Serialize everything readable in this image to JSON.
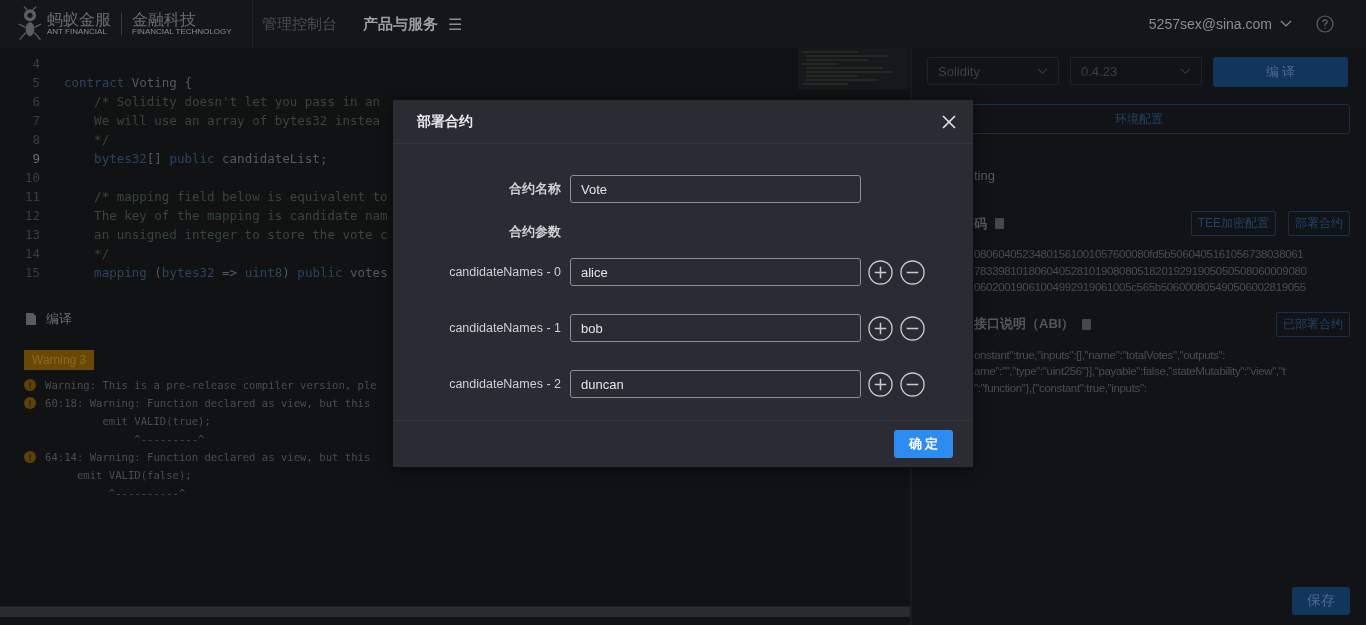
{
  "header": {
    "logo": {
      "brand": "蚂蚁金服",
      "brand_sub": "ANT FINANCIAL",
      "product": "金融科技",
      "product_sub": "FINANCIAL TECHNOLOGY"
    },
    "nav": [
      {
        "label": "管理控制台",
        "selected": false
      },
      {
        "label": "产品与服务",
        "selected": true
      }
    ],
    "menu_glyph": "☰",
    "user": "5257sex@sina.com"
  },
  "editor": {
    "lines": [
      {
        "number": "4",
        "active": false
      },
      {
        "number": "5",
        "active": false,
        "tokens": [
          {
            "kind": "keyword",
            "text": "contract"
          },
          {
            "kind": "plain",
            "text": " Voting {"
          }
        ]
      },
      {
        "number": "6",
        "active": false,
        "tokens": [
          {
            "kind": "comment",
            "text": "    /* Solidity doesn't let you pass in an"
          }
        ]
      },
      {
        "number": "7",
        "active": false,
        "tokens": [
          {
            "kind": "comment",
            "text": "    We will use an array of bytes32 instea"
          }
        ]
      },
      {
        "number": "8",
        "active": false,
        "tokens": [
          {
            "kind": "comment",
            "text": "    */"
          }
        ]
      },
      {
        "number": "9",
        "active": true,
        "tokens": [
          {
            "kind": "keyword",
            "text": "    bytes32"
          },
          {
            "kind": "plain",
            "text": "[] "
          },
          {
            "kind": "keyword",
            "text": "public"
          },
          {
            "kind": "plain",
            "text": " candidateList;"
          }
        ]
      },
      {
        "number": "10",
        "active": false
      },
      {
        "number": "11",
        "active": false,
        "tokens": [
          {
            "kind": "comment",
            "text": "    /* mapping field below is equivalent to"
          }
        ]
      },
      {
        "number": "12",
        "active": false,
        "tokens": [
          {
            "kind": "comment",
            "text": "    The key of the mapping is candidate nam"
          }
        ]
      },
      {
        "number": "13",
        "active": false,
        "tokens": [
          {
            "kind": "comment",
            "text": "    an unsigned integer to store the vote c"
          }
        ]
      },
      {
        "number": "14",
        "active": false,
        "tokens": [
          {
            "kind": "comment",
            "text": "    */"
          }
        ]
      },
      {
        "number": "15",
        "active": false,
        "tokens": [
          {
            "kind": "keyword",
            "text": "    mapping"
          },
          {
            "kind": "plain",
            "text": " ("
          },
          {
            "kind": "keyword",
            "text": "bytes32"
          },
          {
            "kind": "plain",
            "text": " => "
          },
          {
            "kind": "keyword",
            "text": "uint8"
          },
          {
            "kind": "plain",
            "text": ") "
          },
          {
            "kind": "keyword",
            "text": "public"
          },
          {
            "kind": "plain",
            "text": " votes"
          }
        ]
      }
    ]
  },
  "compile": {
    "title": "编译",
    "badge": "Warning 3",
    "messages": [
      {
        "kind": "warning",
        "text": "Warning: This is a pre-release compiler version, ple"
      },
      {
        "kind": "warning",
        "text": "60:18: Warning: Function declared as view, but this"
      },
      {
        "kind": "detail",
        "text": "         emit VALID(true);"
      },
      {
        "kind": "detail",
        "text": "              ^---------^"
      },
      {
        "kind": "warning",
        "text": "64:14: Warning: Function declared as view, but this"
      },
      {
        "kind": "detail",
        "text": "     emit VALID(false);"
      },
      {
        "kind": "detail",
        "text": "          ^----------^"
      }
    ]
  },
  "panel": {
    "language": "Solidity",
    "version": "0.4.23",
    "compile_button": "编 译",
    "env_button": "环境配置",
    "contract_name": "ting",
    "bytecode": {
      "title": "码",
      "buttons": [
        "TEE加密配置",
        "部署合约"
      ],
      "lines": [
        "08060405234801561001057600080fd5b5060405161056738038061",
        "7833981018060405281019080805182019291905050508060009080",
        "06020019061004992919061005c565b506000805490506002819055"
      ]
    },
    "abi": {
      "title": "接口说明（ABI）",
      "button": "已部署合约",
      "lines": [
        "onstant\":true,\"inputs\":[],\"name\":\"totalVotes\",\"outputs\":",
        "ame\":\"\",\"type\":\"uint256\"}],\"payable\":false,\"stateMutability\":\"view\",\"t",
        "\":\"function\"},{\"constant\":true,\"inputs\":"
      ]
    },
    "save_button": "保存"
  },
  "dialog": {
    "title": "部署合约",
    "name_label": "合约名称",
    "name_value": "Vote",
    "params_label": "合约参数",
    "params": [
      {
        "label": "candidateNames - 0",
        "value": "alice"
      },
      {
        "label": "candidateNames - 1",
        "value": "bob"
      },
      {
        "label": "candidateNames - 2",
        "value": "duncan"
      }
    ],
    "confirm": "确 定"
  }
}
